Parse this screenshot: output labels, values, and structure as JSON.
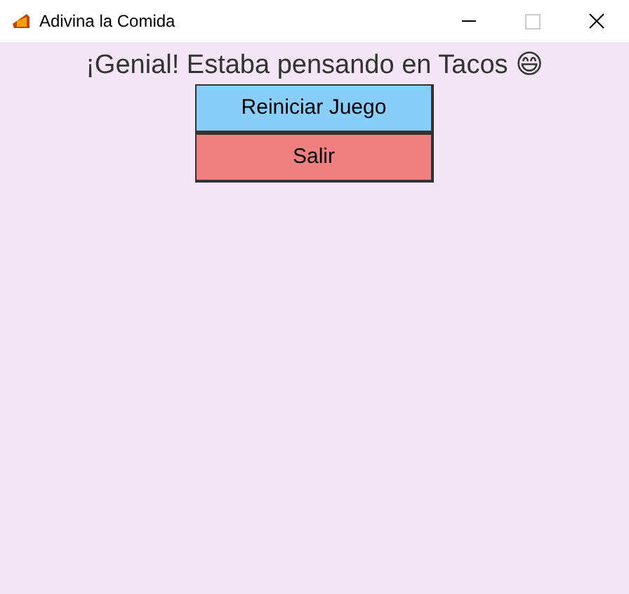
{
  "window": {
    "title": "Adivina la Comida"
  },
  "message": "¡Genial! Estaba pensando en Tacos 😄",
  "buttons": [
    {
      "label": "Reiniciar Juego",
      "color": "#87cefa"
    },
    {
      "label": "Salir",
      "color": "#f08080"
    }
  ]
}
